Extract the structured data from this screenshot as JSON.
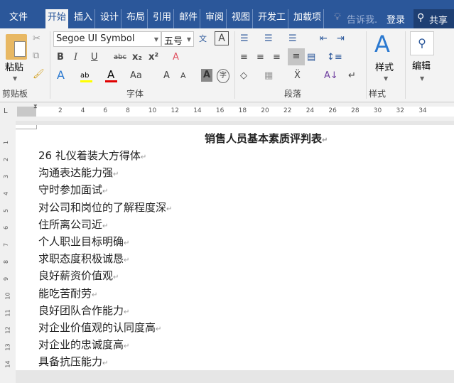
{
  "tabs": [
    "文件",
    "开始",
    "插入",
    "设计",
    "布局",
    "引用",
    "邮件",
    "审阅",
    "视图",
    "开发工",
    "加载项"
  ],
  "tellme": "告诉我.",
  "login": "登录",
  "share": "共享",
  "clipboard": {
    "paste": "粘贴",
    "label": "剪贴板"
  },
  "font": {
    "name": "Segoe UI Symbol",
    "size": "五号",
    "label": "字体",
    "highlight_color": "#ffff00",
    "font_color": "#e00000"
  },
  "paragraph": {
    "label": "段落"
  },
  "styles": {
    "button": "样式",
    "label": "样式"
  },
  "editing": {
    "button": "编辑"
  },
  "ruler": {
    "marks": [
      "2",
      "4",
      "6",
      "8",
      "10",
      "12",
      "14",
      "16",
      "18",
      "20",
      "22",
      "24",
      "26",
      "28",
      "30",
      "32",
      "34"
    ]
  },
  "vruler": {
    "marks": [
      "1",
      "2",
      "3",
      "4",
      "5",
      "6",
      "7",
      "8",
      "9",
      "10",
      "11",
      "12",
      "13",
      "14"
    ]
  },
  "document": {
    "title": "销售人员基本素质评判表",
    "lines": [
      "26 礼仪着装大方得体",
      "沟通表达能力强",
      "守时参加面试",
      "对公司和岗位的了解程度深",
      "住所离公司近",
      "个人职业目标明确",
      "求职态度积极诚恳",
      "良好薪资价值观",
      "能吃苦耐劳",
      "良好团队合作能力",
      "对企业价值观的认同度高",
      "对企业的忠诚度高",
      "具备抗压能力"
    ]
  }
}
